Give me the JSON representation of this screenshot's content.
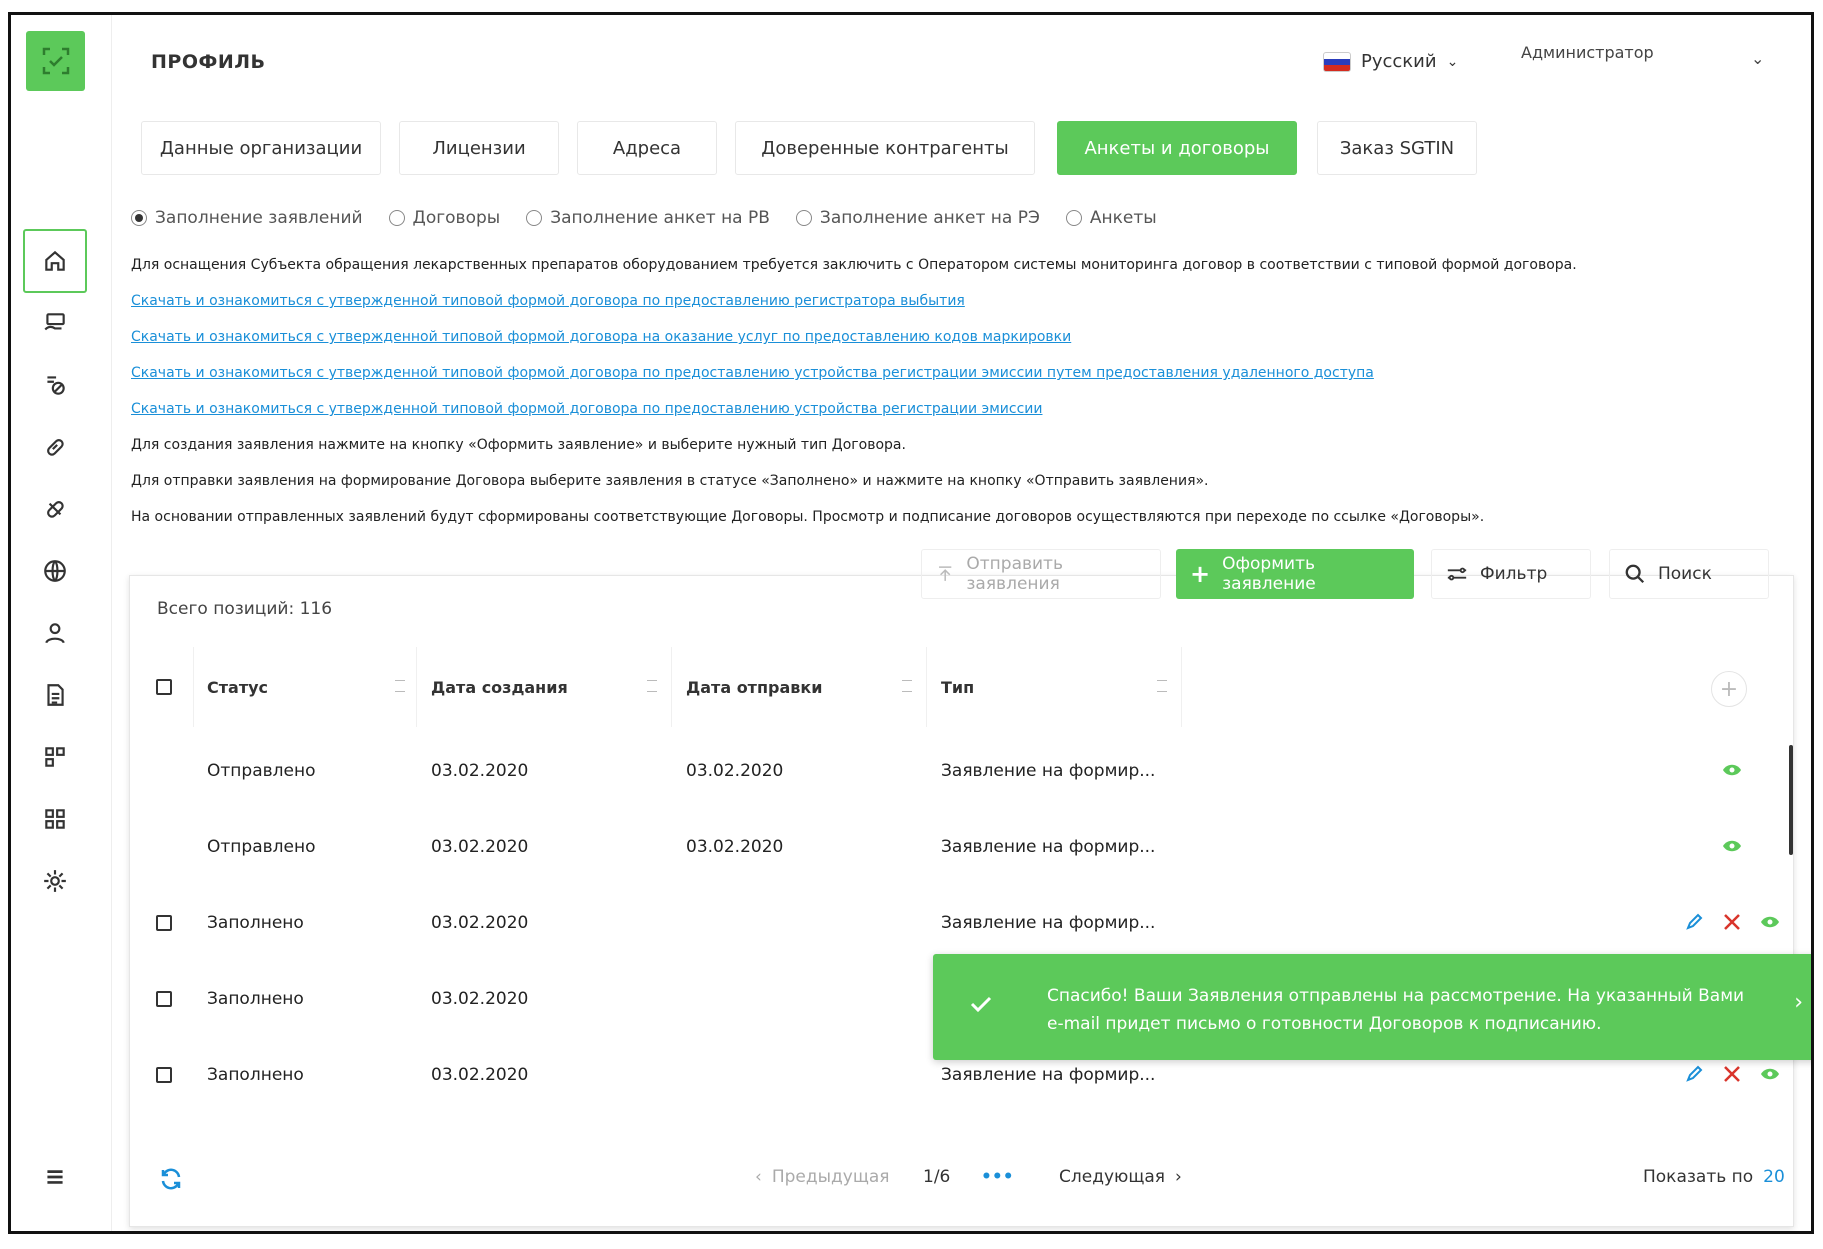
{
  "header": {
    "title": "ПРОФИЛЬ",
    "language": "Русский",
    "user": "Администратор"
  },
  "tabs": [
    {
      "label": "Данные организации"
    },
    {
      "label": "Лицензии"
    },
    {
      "label": "Адреса"
    },
    {
      "label": "Доверенные контрагенты"
    },
    {
      "label": "Анкеты и договоры",
      "active": true
    },
    {
      "label": "Заказ SGTIN"
    }
  ],
  "radios": [
    {
      "label": "Заполнение заявлений",
      "checked": true
    },
    {
      "label": "Договоры"
    },
    {
      "label": "Заполнение анкет на РВ"
    },
    {
      "label": "Заполнение анкет на РЭ"
    },
    {
      "label": "Анкеты"
    }
  ],
  "info": {
    "intro": "Для оснащения Субъекта обращения лекарственных препаратов оборудованием требуется заключить с Оператором системы мониторинга договор в соответствии с типовой формой договора.",
    "link1": "Скачать и ознакомиться с утвержденной типовой формой договора по предоставлению регистратора выбытия",
    "link2": "Скачать и ознакомиться с утвержденной типовой формой договора на оказание услуг по предоставлению кодов маркировки",
    "link3": "Скачать и ознакомиться с утвержденной типовой формой договора по предоставлению устройства регистрации эмиссии путем предоставления удаленного доступа",
    "link4": "Скачать и ознакомиться с утвержденной типовой формой договора по предоставлению устройства регистрации эмиссии",
    "note1": "Для создания заявления нажмите на кнопку «Оформить заявление» и выберите нужный тип Договора.",
    "note2": "Для отправки заявления на формирование Договора выберите заявления в статусе «Заполнено» и нажмите на кнопку «Отправить заявления».",
    "note3": "На основании отправленных заявлений будут сформированы соответствующие Договоры. Просмотр и подписание договоров осуществляются при переходе по ссылке «Договоры»."
  },
  "toolbar": {
    "send": "Отправить заявления",
    "create": "Оформить заявление",
    "filter": "Фильтр",
    "search": "Поиск"
  },
  "table": {
    "total": "Всего позиций: 116",
    "columns": [
      "Статус",
      "Дата создания",
      "Дата отправки",
      "Тип"
    ],
    "rows": [
      {
        "status": "Отправлено",
        "created": "03.02.2020",
        "sent": "03.02.2020",
        "type": "Заявление на формир..."
      },
      {
        "status": "Отправлено",
        "created": "03.02.2020",
        "sent": "03.02.2020",
        "type": "Заявление на формир..."
      },
      {
        "status": "Заполнено",
        "created": "03.02.2020",
        "sent": "",
        "type": "Заявление на формир..."
      },
      {
        "status": "Заполнено",
        "created": "03.02.2020",
        "sent": "",
        "type": ""
      },
      {
        "status": "Заполнено",
        "created": "03.02.2020",
        "sent": "",
        "type": "Заявление на формир..."
      }
    ]
  },
  "toast": {
    "message": "Спасибо! Ваши Заявления отправлены на рассмотрение. На указанный Вами e-mail придет письмо о готовности Договоров к подписанию."
  },
  "pagination": {
    "prev": "Предыдущая",
    "page": "1/6",
    "dots": "•••",
    "next": "Следующая",
    "show_label": "Показать по",
    "show_value": "20"
  },
  "sidebar": {
    "icons": [
      "home-icon",
      "payment-icon",
      "pills-icon",
      "link-icon",
      "pill-icon",
      "globe-icon",
      "user-icon",
      "document-icon",
      "blocks-icon",
      "grid-icon",
      "settings-icon",
      "menu-icon"
    ]
  },
  "colors": {
    "accent": "#5cc95a",
    "link": "#1a8fd8",
    "danger": "#d9342b"
  }
}
